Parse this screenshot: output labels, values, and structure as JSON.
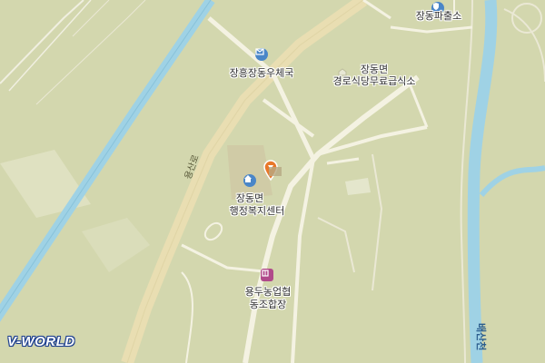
{
  "map": {
    "background": "#d3d7ae",
    "water_color": "#9fd2e5",
    "major_road_color": "#eadfb4",
    "minor_road_color": "#f4f2e2"
  },
  "labels": {
    "police": "장동파출소",
    "post_office": "장흥장동우체국",
    "senior_meal_line1": "장동면",
    "senior_meal_line2": "경로식당무료급식소",
    "welfare_line1": "장동면",
    "welfare_line2": "행정복지센터",
    "coop_line1": "용두농업협",
    "coop_line2": "동조합장",
    "road_name": "용산로",
    "stream_name": "배산천"
  },
  "icons": {
    "police": "police-icon",
    "post_office": "post-office-icon",
    "senior_meal": "landmark-icon",
    "welfare": "home-icon",
    "coop": "bank-icon",
    "marker": "location-pin-icon"
  },
  "brand": {
    "logo_text": "V-WORLD"
  }
}
